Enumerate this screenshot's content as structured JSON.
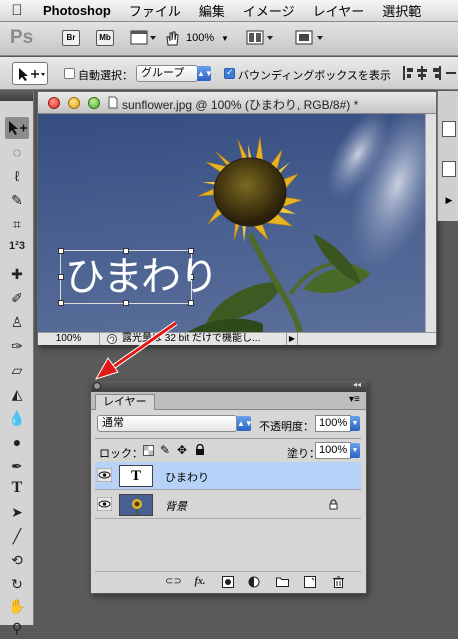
{
  "menubar": {
    "app": "Photoshop",
    "items": [
      "ファイル",
      "編集",
      "イメージ",
      "レイヤー",
      "選択範"
    ]
  },
  "appbar": {
    "logo": "Ps",
    "bridge_label": "Br",
    "minibridge_label": "Mb",
    "zoom": "100%"
  },
  "options": {
    "auto_select_label": "自動選択：",
    "group_select": "グループ",
    "bounding_box_label": "バウンディングボックスを表示"
  },
  "document": {
    "title": "sunflower.jpg @ 100% (ひまわり, RGB/8#) *",
    "canvas_text": "ひまわり",
    "status_zoom": "100%",
    "status_message": "露光量は 32 bit だけで機能し..."
  },
  "layers_panel": {
    "tab": "レイヤー",
    "blend_mode": "通常",
    "opacity_label": "不透明度：",
    "opacity_value": "100%",
    "lock_label": "ロック：",
    "fill_label": "塗り：",
    "fill_value": "100%",
    "layers": [
      {
        "name": "ひまわり",
        "type": "text",
        "thumb_label": "T"
      },
      {
        "name": "背景",
        "type": "image"
      }
    ]
  },
  "colors": {
    "selection_blue": "#b7d2f8",
    "arrow_red": "#e01818",
    "sky": "#475e8f"
  }
}
